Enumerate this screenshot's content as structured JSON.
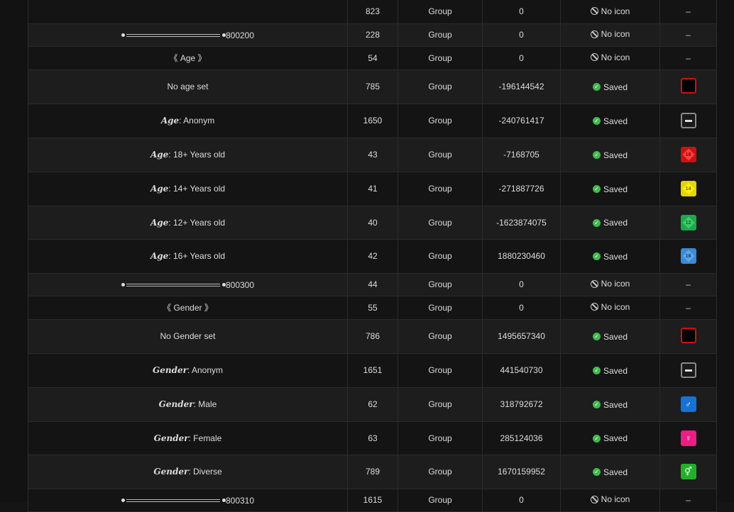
{
  "rows": [
    {
      "kind": "plain",
      "label": "",
      "id": "823",
      "type": "Group",
      "sort": "0",
      "status": "noicon",
      "status_text": "No icon",
      "icon": "none",
      "icon_text": "–",
      "h": 33
    },
    {
      "kind": "divider",
      "label": "800200",
      "id": "228",
      "type": "Group",
      "sort": "0",
      "status": "noicon",
      "status_text": "No icon",
      "icon": "none",
      "icon_text": "–",
      "h": 32
    },
    {
      "kind": "plain",
      "label": "《 Age 》",
      "id": "54",
      "type": "Group",
      "sort": "0",
      "status": "noicon",
      "status_text": "No icon",
      "icon": "none",
      "icon_text": "–",
      "h": 33
    },
    {
      "kind": "plain",
      "label": "No age set",
      "id": "785",
      "type": "Group",
      "sort": "-196144542",
      "status": "saved",
      "status_text": "Saved",
      "icon": "black",
      "icon_text": "",
      "h": 48
    },
    {
      "kind": "pair",
      "key": "Age",
      "value": ": Anonym",
      "id": "1650",
      "type": "Group",
      "sort": "-240761417",
      "status": "saved",
      "status_text": "Saved",
      "icon": "anon",
      "icon_text": "",
      "h": 48
    },
    {
      "kind": "pair",
      "key": "Age",
      "value": ": 18+ Years old",
      "id": "43",
      "type": "Group",
      "sort": "-7168705",
      "status": "saved",
      "status_text": "Saved",
      "icon": "red",
      "icon_text": "18",
      "h": 48
    },
    {
      "kind": "pair",
      "key": "Age",
      "value": ": 14+ Years old",
      "id": "41",
      "type": "Group",
      "sort": "-271887726",
      "status": "saved",
      "status_text": "Saved",
      "icon": "yellow",
      "icon_text": "14",
      "h": 48
    },
    {
      "kind": "pair",
      "key": "Age",
      "value": ": 12+ Years old",
      "id": "40",
      "type": "Group",
      "sort": "-1623874075",
      "status": "saved",
      "status_text": "Saved",
      "icon": "green",
      "icon_text": "12",
      "h": 47
    },
    {
      "kind": "pair",
      "key": "Age",
      "value": ": 16+ Years old",
      "id": "42",
      "type": "Group",
      "sort": "1880230460",
      "status": "saved",
      "status_text": "Saved",
      "icon": "blue",
      "icon_text": "16",
      "h": 48
    },
    {
      "kind": "divider",
      "label": "800300",
      "id": "44",
      "type": "Group",
      "sort": "0",
      "status": "noicon",
      "status_text": "No icon",
      "icon": "none",
      "icon_text": "–",
      "h": 32
    },
    {
      "kind": "plain",
      "label": "《 Gender 》",
      "id": "55",
      "type": "Group",
      "sort": "0",
      "status": "noicon",
      "status_text": "No icon",
      "icon": "none",
      "icon_text": "–",
      "h": 33
    },
    {
      "kind": "plain",
      "label": "No Gender set",
      "id": "786",
      "type": "Group",
      "sort": "1495657340",
      "status": "saved",
      "status_text": "Saved",
      "icon": "black",
      "icon_text": "",
      "h": 48
    },
    {
      "kind": "pair",
      "key": "Gender",
      "value": ": Anonym",
      "id": "1651",
      "type": "Group",
      "sort": "441540730",
      "status": "saved",
      "status_text": "Saved",
      "icon": "anon",
      "icon_text": "",
      "h": 48
    },
    {
      "kind": "pair",
      "key": "Gender",
      "value": ": Male",
      "id": "62",
      "type": "Group",
      "sort": "318792672",
      "status": "saved",
      "status_text": "Saved",
      "icon": "male",
      "icon_text": "♂",
      "h": 48
    },
    {
      "kind": "pair",
      "key": "Gender",
      "value": ": Female",
      "id": "63",
      "type": "Group",
      "sort": "285124036",
      "status": "saved",
      "status_text": "Saved",
      "icon": "female",
      "icon_text": "♀",
      "h": 47
    },
    {
      "kind": "pair",
      "key": "Gender",
      "value": ": Diverse",
      "id": "789",
      "type": "Group",
      "sort": "1670159952",
      "status": "saved",
      "status_text": "Saved",
      "icon": "diverse",
      "icon_text": "⚥",
      "h": 48
    },
    {
      "kind": "divider",
      "label": "800310",
      "id": "1615",
      "type": "Group",
      "sort": "0",
      "status": "noicon",
      "status_text": "No icon",
      "icon": "none",
      "icon_text": "–",
      "h": 32
    }
  ]
}
